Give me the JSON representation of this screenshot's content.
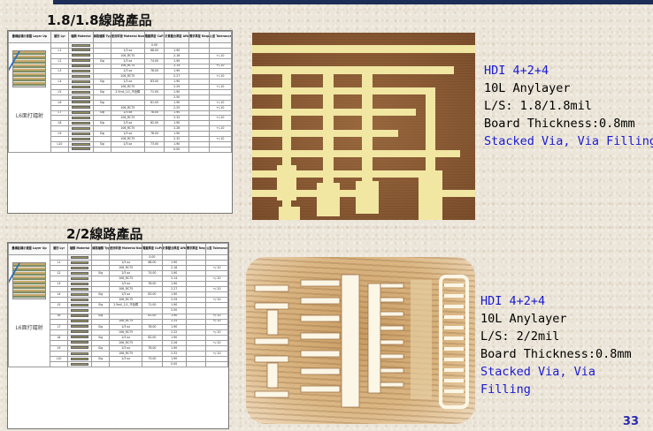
{
  "section1": {
    "title": "1.8/1.8線路產品"
  },
  "section2": {
    "title": "2/2線路產品"
  },
  "table": {
    "headers": [
      "疊構結構示意圖 Layer Up",
      "層別 Lyr",
      "種類 Material",
      "線路種類 Typ",
      "使用料號 Material Name",
      "電鍍厚度 CuPs",
      "計算壓合厚度 After Lam",
      "需求厚度 Reqqred",
      "公差 Tolerance"
    ],
    "layup_note": "L6面打鐳射",
    "rows": [
      [
        "",
        "",
        "",
        "",
        "0.00",
        "",
        ""
      ],
      [
        "L1",
        "",
        "",
        "1/3 oz",
        "68.00",
        "1.90",
        ""
      ],
      [
        "",
        "",
        "",
        "106_RC75",
        "",
        "2.16",
        "+/-10"
      ],
      [
        "L2",
        "",
        "Sig",
        "1/3 oz",
        "74.00",
        "1.90",
        ""
      ],
      [
        "",
        "",
        "",
        "106_RC75",
        "",
        "2.14",
        "+/-10"
      ],
      [
        "L3",
        "",
        "",
        "1/3 oz",
        "78.00",
        "1.90",
        ""
      ],
      [
        "",
        "",
        "",
        "106_RC75",
        "",
        "2.27",
        "+/-10"
      ],
      [
        "L4",
        "",
        "Sig",
        "1/3 oz",
        "83.00",
        "1.90",
        ""
      ],
      [
        "",
        "",
        "",
        "106_RC75",
        "",
        "2.29",
        "+/-10"
      ],
      [
        "L5",
        "",
        "Sig",
        "2.5mil_1/1_不含銅",
        "71.00",
        "1.90",
        ""
      ],
      [
        "",
        "",
        "",
        "",
        "",
        "2.50",
        ""
      ],
      [
        "L6",
        "",
        "Sig",
        "",
        "81.00",
        "1.90",
        "+/-10"
      ],
      [
        "",
        "",
        "",
        "106_RC75",
        "",
        "2.25",
        "+/-10"
      ],
      [
        "L7",
        "",
        "Sig",
        "1/3 oz",
        "78.00",
        "1.90",
        ""
      ],
      [
        "",
        "",
        "",
        "106_RC75",
        "",
        "2.32",
        "+/-10"
      ],
      [
        "L8",
        "",
        "Sig",
        "1/3 oz",
        "82.00",
        "1.90",
        ""
      ],
      [
        "",
        "",
        "",
        "106_RC75",
        "",
        "2.26",
        "+/-10"
      ],
      [
        "L9",
        "",
        "Sig",
        "1/3 oz",
        "78.00",
        "1.90",
        ""
      ],
      [
        "",
        "",
        "",
        "106_RC75",
        "",
        "2.32",
        "+/-10"
      ],
      [
        "L10",
        "",
        "Sig",
        "1/3 oz",
        "73.00",
        "1.90",
        ""
      ],
      [
        "",
        "",
        "",
        "",
        "",
        "0.00",
        ""
      ]
    ]
  },
  "spec1": {
    "line1": "HDI 4+2+4",
    "line2": "10L Anylayer",
    "line3": "L/S: 1.8/1.8mil",
    "line4": "Board Thickness:0.8mm",
    "line5": "Stacked Via, Via Filling"
  },
  "spec2": {
    "line1": "HDI 4+2+4",
    "line2": "10L Anylayer",
    "line3": "L/S: 2/2mil",
    "line4": "Board Thickness:0.8mm",
    "line5": "Stacked Via, Via",
    "line6": "Filling"
  },
  "page_number": "33",
  "colors": {
    "spec_blue": "#1a1acf",
    "topbar": "#1c2e58",
    "copper": "#f0e7a0"
  }
}
